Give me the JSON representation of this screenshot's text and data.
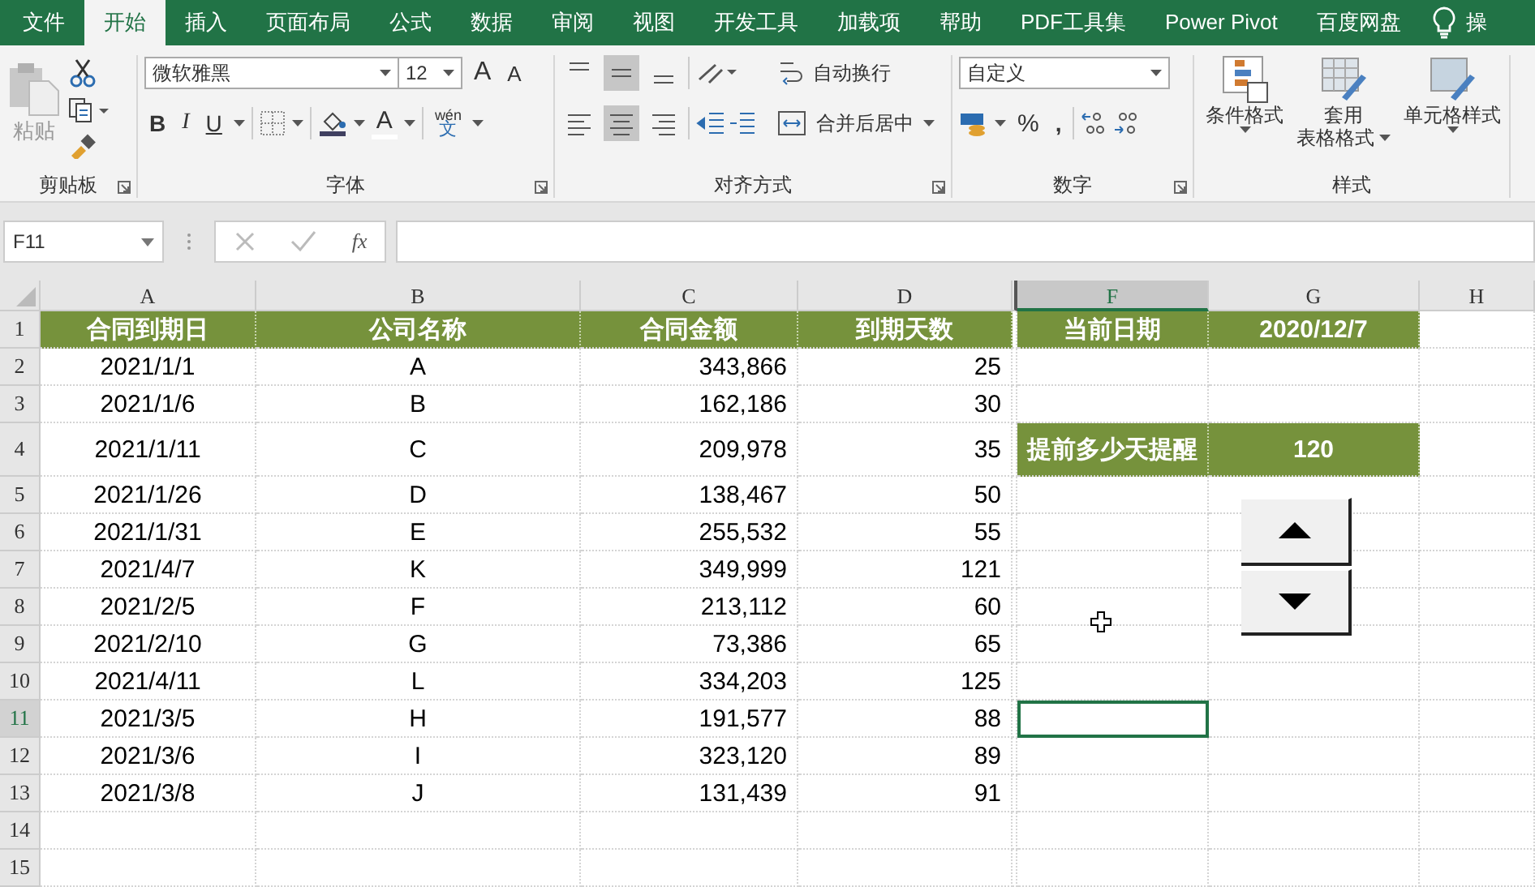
{
  "tabs": [
    {
      "label": "文件",
      "selected": false
    },
    {
      "label": "开始",
      "selected": true
    },
    {
      "label": "插入",
      "selected": false
    },
    {
      "label": "页面布局",
      "selected": false
    },
    {
      "label": "公式",
      "selected": false
    },
    {
      "label": "数据",
      "selected": false
    },
    {
      "label": "审阅",
      "selected": false
    },
    {
      "label": "视图",
      "selected": false
    },
    {
      "label": "开发工具",
      "selected": false
    },
    {
      "label": "加载项",
      "selected": false
    },
    {
      "label": "帮助",
      "selected": false
    },
    {
      "label": "PDF工具集",
      "selected": false
    },
    {
      "label": "Power Pivot",
      "selected": false
    },
    {
      "label": "百度网盘",
      "selected": false
    }
  ],
  "tell_me": "操",
  "clipboard": {
    "paste": "粘贴",
    "title": "剪贴板"
  },
  "font": {
    "name": "微软雅黑",
    "size": "12",
    "grow": "A",
    "shrink": "A",
    "bold": "B",
    "italic": "I",
    "underline": "U",
    "color_letter": "A",
    "pinyin": "wén",
    "pinyin_char": "文",
    "title": "字体"
  },
  "alignment": {
    "wrap": "自动换行",
    "merge": "合并后居中",
    "title": "对齐方式"
  },
  "number": {
    "format": "自定义",
    "percent": "%",
    "comma": ",",
    "title": "数字"
  },
  "styles": {
    "conditional": "条件格式",
    "table_lines": [
      "套用",
      "表格格式"
    ],
    "cell_styles": "单元格样式",
    "title": "样式"
  },
  "formula_bar": {
    "name_box": "F11",
    "fx": "fx"
  },
  "columns": [
    {
      "label": "A",
      "selected": false
    },
    {
      "label": "B",
      "selected": false
    },
    {
      "label": "C",
      "selected": false
    },
    {
      "label": "D",
      "selected": false
    },
    {
      "hidden": true
    },
    {
      "label": "F",
      "selected": true
    },
    {
      "label": "G",
      "selected": false
    },
    {
      "label": "H",
      "selected": false
    }
  ],
  "rows": [
    {
      "number": "1",
      "selected": false,
      "cells": [
        {
          "text": "合同到期日",
          "kind": "header"
        },
        {
          "text": "公司名称",
          "kind": "header"
        },
        {
          "text": "合同金额",
          "kind": "header"
        },
        {
          "text": "到期天数",
          "kind": "header"
        },
        null,
        {
          "text": "当前日期",
          "kind": "header"
        },
        {
          "text": "2020/12/7",
          "kind": "header"
        },
        null
      ]
    },
    {
      "number": "2",
      "selected": false,
      "cells": [
        {
          "text": "2021/1/1",
          "kind": "text"
        },
        {
          "text": "A",
          "kind": "text"
        },
        {
          "text": "343,866",
          "kind": "number"
        },
        {
          "text": "25",
          "kind": "number"
        },
        null,
        null,
        null,
        null
      ]
    },
    {
      "number": "3",
      "selected": false,
      "cells": [
        {
          "text": "2021/1/6",
          "kind": "text"
        },
        {
          "text": "B",
          "kind": "text"
        },
        {
          "text": "162,186",
          "kind": "number"
        },
        {
          "text": "30",
          "kind": "number"
        },
        null,
        null,
        null,
        null
      ]
    },
    {
      "number": "4",
      "selected": false,
      "cells": [
        {
          "text": "2021/1/11",
          "kind": "text"
        },
        {
          "text": "C",
          "kind": "text"
        },
        {
          "text": "209,978",
          "kind": "number"
        },
        {
          "text": "35",
          "kind": "number"
        },
        null,
        {
          "text": "提前多少天提醒",
          "kind": "header"
        },
        {
          "text": "120",
          "kind": "header"
        },
        null
      ]
    },
    {
      "number": "5",
      "selected": false,
      "cells": [
        {
          "text": "2021/1/26",
          "kind": "text"
        },
        {
          "text": "D",
          "kind": "text"
        },
        {
          "text": "138,467",
          "kind": "number"
        },
        {
          "text": "50",
          "kind": "number"
        },
        null,
        null,
        null,
        null
      ]
    },
    {
      "number": "6",
      "selected": false,
      "cells": [
        {
          "text": "2021/1/31",
          "kind": "text"
        },
        {
          "text": "E",
          "kind": "text"
        },
        {
          "text": "255,532",
          "kind": "number"
        },
        {
          "text": "55",
          "kind": "number"
        },
        null,
        null,
        null,
        null
      ]
    },
    {
      "number": "7",
      "selected": false,
      "cells": [
        {
          "text": "2021/4/7",
          "kind": "text"
        },
        {
          "text": "K",
          "kind": "text"
        },
        {
          "text": "349,999",
          "kind": "number"
        },
        {
          "text": "121",
          "kind": "number"
        },
        null,
        null,
        null,
        null
      ]
    },
    {
      "number": "8",
      "selected": false,
      "cells": [
        {
          "text": "2021/2/5",
          "kind": "text"
        },
        {
          "text": "F",
          "kind": "text"
        },
        {
          "text": "213,112",
          "kind": "number"
        },
        {
          "text": "60",
          "kind": "number"
        },
        null,
        null,
        null,
        null
      ]
    },
    {
      "number": "9",
      "selected": false,
      "cells": [
        {
          "text": "2021/2/10",
          "kind": "text"
        },
        {
          "text": "G",
          "kind": "text"
        },
        {
          "text": "73,386",
          "kind": "number"
        },
        {
          "text": "65",
          "kind": "number"
        },
        null,
        null,
        null,
        null
      ]
    },
    {
      "number": "10",
      "selected": false,
      "cells": [
        {
          "text": "2021/4/11",
          "kind": "text"
        },
        {
          "text": "L",
          "kind": "text"
        },
        {
          "text": "334,203",
          "kind": "number"
        },
        {
          "text": "125",
          "kind": "number"
        },
        null,
        null,
        null,
        null
      ]
    },
    {
      "number": "11",
      "selected": true,
      "cells": [
        {
          "text": "2021/3/5",
          "kind": "text"
        },
        {
          "text": "H",
          "kind": "text"
        },
        {
          "text": "191,577",
          "kind": "number"
        },
        {
          "text": "88",
          "kind": "number"
        },
        null,
        {
          "kind": "active"
        },
        null,
        null
      ]
    },
    {
      "number": "12",
      "selected": false,
      "cells": [
        {
          "text": "2021/3/6",
          "kind": "text"
        },
        {
          "text": "I",
          "kind": "text"
        },
        {
          "text": "323,120",
          "kind": "number"
        },
        {
          "text": "89",
          "kind": "number"
        },
        null,
        null,
        null,
        null
      ]
    },
    {
      "number": "13",
      "selected": false,
      "cells": [
        {
          "text": "2021/3/8",
          "kind": "text"
        },
        {
          "text": "J",
          "kind": "text"
        },
        {
          "text": "131,439",
          "kind": "number"
        },
        {
          "text": "91",
          "kind": "number"
        },
        null,
        null,
        null,
        null
      ]
    },
    {
      "number": "14",
      "selected": false,
      "cells": [
        null,
        null,
        null,
        null,
        null,
        null,
        null,
        null
      ]
    },
    {
      "number": "15",
      "selected": false,
      "cells": [
        null,
        null,
        null,
        null,
        null,
        null,
        null,
        null
      ]
    }
  ]
}
